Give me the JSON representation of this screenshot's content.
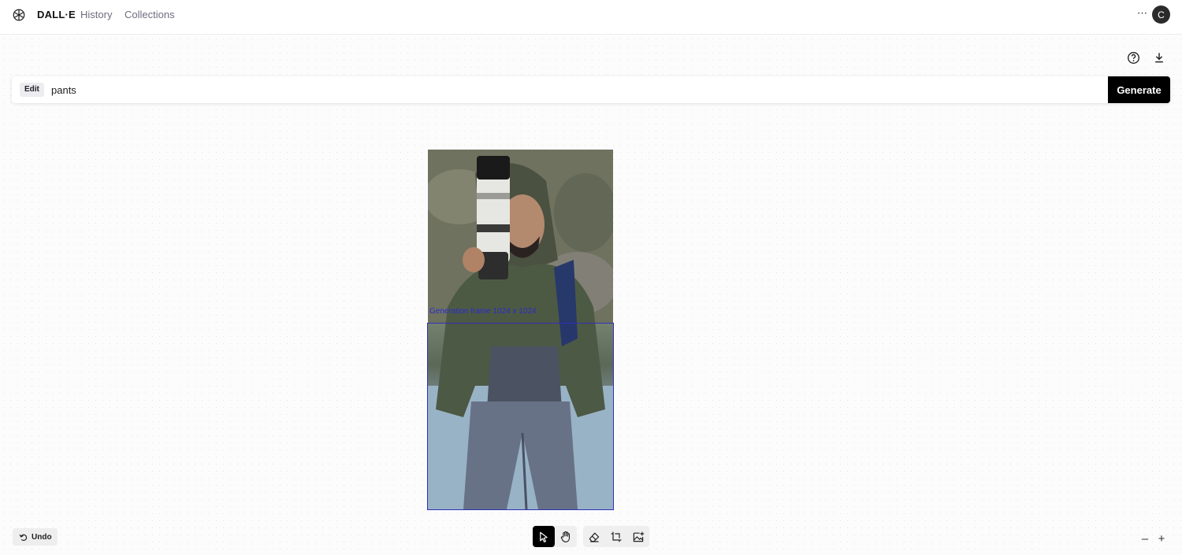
{
  "header": {
    "brand": "DALL·E",
    "nav": [
      "History",
      "Collections"
    ],
    "more_icon": "more-horizontal-icon",
    "avatar_initial": "C"
  },
  "toolbar_top": {
    "help_icon": "help-icon",
    "download_icon": "download-icon"
  },
  "prompt": {
    "badge": "Edit",
    "value": "pants",
    "generate_label": "Generate"
  },
  "canvas": {
    "selection_label": "Generation frame  1024 x 1024"
  },
  "bottom": {
    "undo_label": "Undo",
    "tools": [
      "select-icon",
      "hand-icon",
      "eraser-icon",
      "add-frame-icon",
      "upload-image-icon"
    ],
    "active_tool": "select-icon",
    "zoom_out": "–",
    "zoom_in": "+"
  },
  "colors": {
    "accent": "#000000",
    "selection": "#2f2fb4"
  }
}
